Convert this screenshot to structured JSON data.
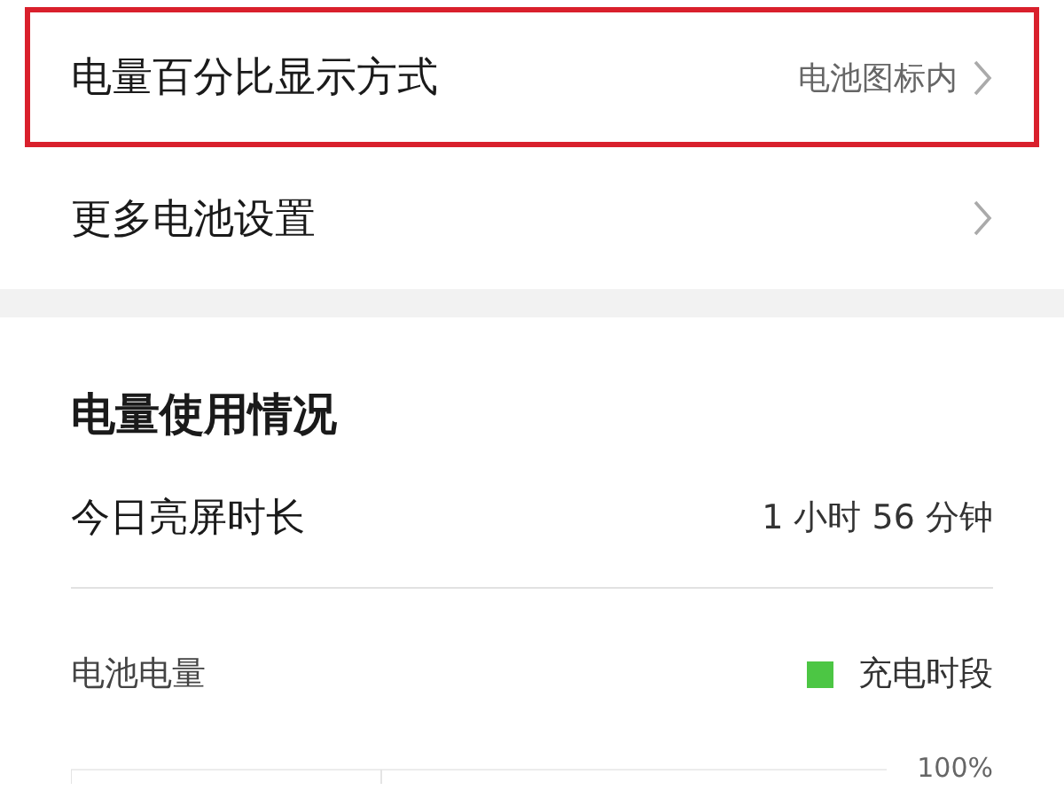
{
  "settings": [
    {
      "label": "电量百分比显示方式",
      "value": "电池图标内",
      "highlighted": true
    },
    {
      "label": "更多电池设置",
      "highlighted": false
    }
  ],
  "usage": {
    "title": "电量使用情况",
    "screen_time": {
      "label": "今日亮屏时长",
      "value": "1 小时 56 分钟"
    },
    "battery": {
      "label": "电池电量",
      "legend": {
        "label": "充电时段",
        "color": "#4cc644"
      },
      "axis_label": "100%"
    }
  }
}
